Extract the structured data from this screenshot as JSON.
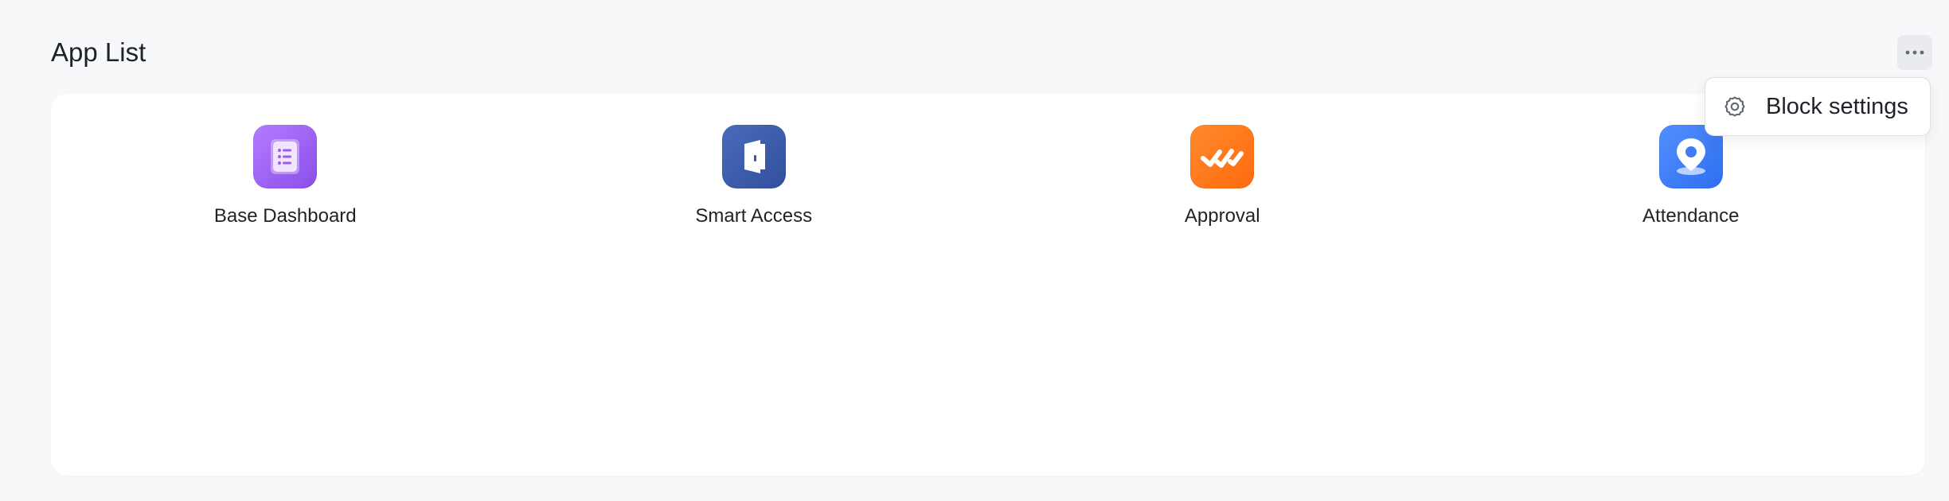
{
  "block": {
    "title": "App List",
    "more_icon": "more-horizontal-icon"
  },
  "apps": [
    {
      "label": "Base Dashboard",
      "icon": "base-dashboard-icon",
      "color": "#9b5cf0"
    },
    {
      "label": "Smart Access",
      "icon": "smart-access-door-icon",
      "color": "#3b5aa8"
    },
    {
      "label": "Approval",
      "icon": "approval-check-icon",
      "color": "#ff7a1a"
    },
    {
      "label": "Attendance",
      "icon": "attendance-location-icon",
      "color": "#3f7cf6"
    }
  ],
  "menu": {
    "items": [
      {
        "label": "Block settings",
        "icon": "gear-icon"
      }
    ]
  },
  "colors": {
    "background": "#f7f8fa",
    "card": "#ffffff",
    "text": "#1f2329"
  }
}
